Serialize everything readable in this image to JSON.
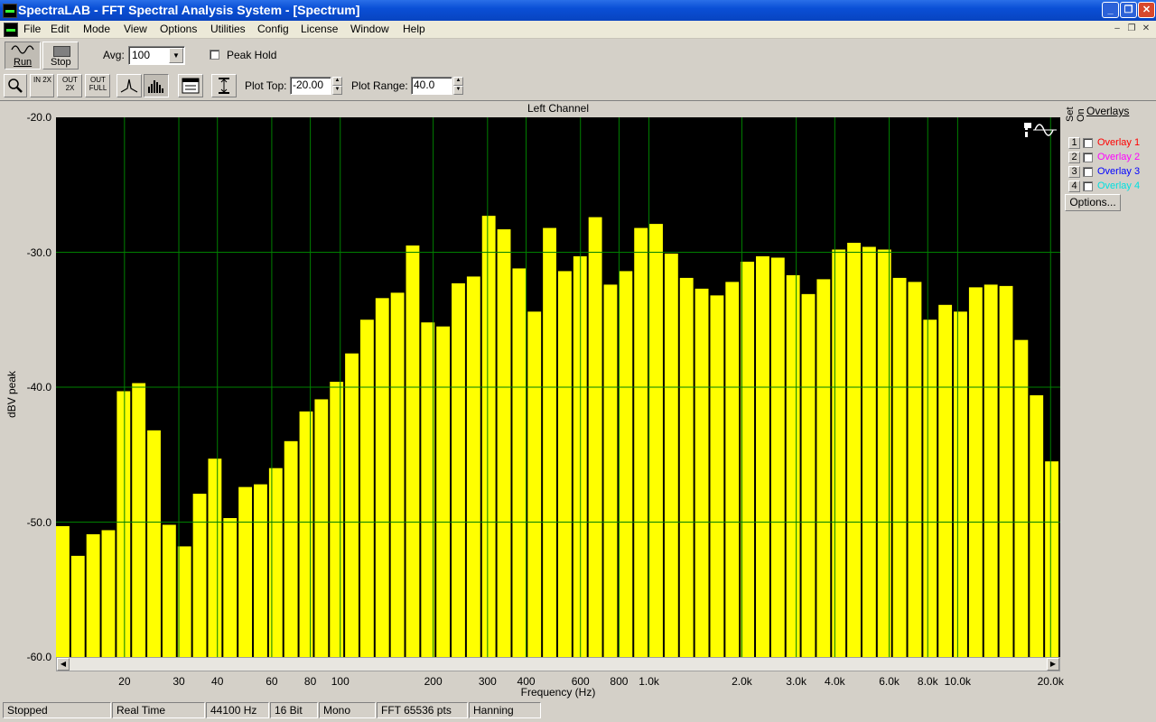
{
  "window": {
    "title": "SpectraLAB - FFT Spectral Analysis System - [Spectrum]"
  },
  "menu": [
    "File",
    "Edit",
    "Mode",
    "View",
    "Options",
    "Utilities",
    "Config",
    "License",
    "Window",
    "Help"
  ],
  "toolbar1": {
    "run_label": "Run",
    "stop_label": "Stop",
    "avg_label": "Avg:",
    "avg_value": "100",
    "peak_hold_label": "Peak Hold"
  },
  "toolbar2": {
    "zoom_in_label": "IN 2X",
    "zoom_out_label": "OUT 2X",
    "zoom_full_label": "OUT FULL",
    "plot_top_label": "Plot Top:",
    "plot_top_value": "-20.00",
    "plot_range_label": "Plot Range:",
    "plot_range_value": "40.0"
  },
  "overlays": {
    "title": "Overlays",
    "set_label": "Set",
    "on_label": "On",
    "items": [
      {
        "num": "1",
        "label": "Overlay 1",
        "color": "#ff0000"
      },
      {
        "num": "2",
        "label": "Overlay 2",
        "color": "#ff00ff"
      },
      {
        "num": "3",
        "label": "Overlay 3",
        "color": "#0000ff"
      },
      {
        "num": "4",
        "label": "Overlay 4",
        "color": "#00e0e0"
      }
    ],
    "options_label": "Options..."
  },
  "status": [
    "Stopped",
    "Real Time",
    "44100 Hz",
    "16 Bit",
    "Mono",
    "FFT 65536 pts",
    "Hanning"
  ],
  "chart_data": {
    "type": "bar",
    "title": "Left Channel",
    "xlabel": "Frequency (Hz)",
    "ylabel": "dBV peak",
    "x_scale": "log",
    "xlim": [
      12,
      21500
    ],
    "ylim": [
      -60,
      -20
    ],
    "bar_color": "#ffff00",
    "background": "#000000",
    "grid_color": "#008000",
    "y_ticks": [
      "-20.0",
      "-30.0",
      "-40.0",
      "-50.0",
      "-60.0"
    ],
    "x_ticks": [
      {
        "v": 20,
        "t": "20"
      },
      {
        "v": 30,
        "t": "30"
      },
      {
        "v": 40,
        "t": "40"
      },
      {
        "v": 60,
        "t": "60"
      },
      {
        "v": 80,
        "t": "80"
      },
      {
        "v": 100,
        "t": "100"
      },
      {
        "v": 200,
        "t": "200"
      },
      {
        "v": 300,
        "t": "300"
      },
      {
        "v": 400,
        "t": "400"
      },
      {
        "v": 600,
        "t": "600"
      },
      {
        "v": 800,
        "t": "800"
      },
      {
        "v": 1000,
        "t": "1.0k"
      },
      {
        "v": 2000,
        "t": "2.0k"
      },
      {
        "v": 3000,
        "t": "3.0k"
      },
      {
        "v": 4000,
        "t": "4.0k"
      },
      {
        "v": 6000,
        "t": "6.0k"
      },
      {
        "v": 8000,
        "t": "8.0k"
      },
      {
        "v": 10000,
        "t": "10.0k"
      },
      {
        "v": 20000,
        "t": "20.0k"
      }
    ],
    "values": [
      -50.3,
      -52.5,
      -50.9,
      -50.6,
      -40.3,
      -39.7,
      -43.2,
      -50.2,
      -51.8,
      -47.9,
      -45.3,
      -49.7,
      -47.4,
      -47.2,
      -46.0,
      -44.0,
      -41.8,
      -40.9,
      -39.6,
      -37.5,
      -35.0,
      -33.4,
      -33.0,
      -29.5,
      -35.2,
      -35.5,
      -32.3,
      -31.8,
      -27.3,
      -28.3,
      -31.2,
      -34.4,
      -28.2,
      -31.4,
      -30.3,
      -27.4,
      -32.4,
      -31.4,
      -28.2,
      -27.9,
      -30.1,
      -31.9,
      -32.7,
      -33.2,
      -32.2,
      -30.7,
      -30.3,
      -30.4,
      -31.7,
      -33.1,
      -32.0,
      -29.8,
      -29.3,
      -29.6,
      -29.8,
      -31.9,
      -32.2,
      -35.0,
      -33.9,
      -34.4,
      -32.6,
      -32.4,
      -32.5,
      -36.5,
      -40.6,
      -45.5
    ]
  }
}
